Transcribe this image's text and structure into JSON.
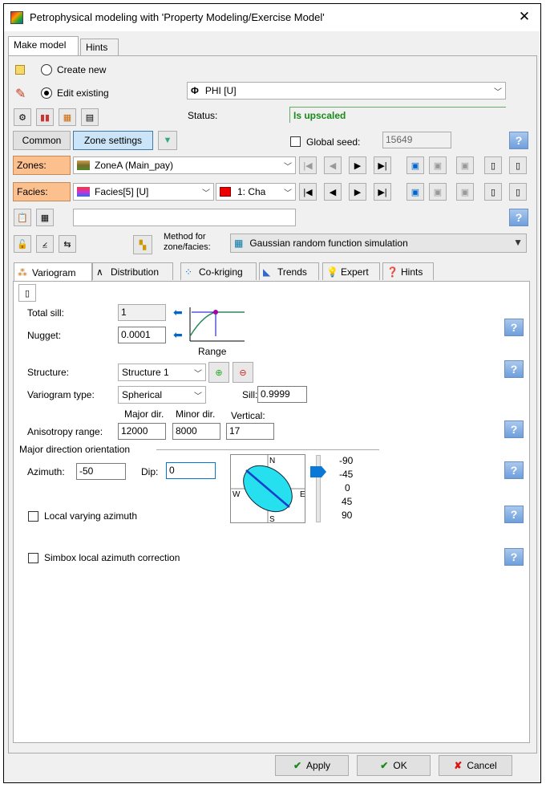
{
  "title": "Petrophysical modeling with 'Property Modeling/Exercise Model'",
  "tabs": [
    "Make model",
    "Hints"
  ],
  "create_new": "Create new",
  "edit_existing": "Edit existing",
  "property": "PHI [U]",
  "status_label": "Status:",
  "status_value": "Is upscaled",
  "common": "Common",
  "zone_settings": "Zone settings",
  "global_seed": "Global seed:",
  "seed_value": "15649",
  "zones_label": "Zones:",
  "zone_value": "ZoneA (Main_pay)",
  "facies_label": "Facies:",
  "facies_value": "Facies[5] [U]",
  "facies_code": "1: Cha",
  "method_label": "Method for\nzone/facies:",
  "method_value": "Gaussian random function simulation",
  "subtabs": [
    "Variogram",
    "Distribution",
    "Co-kriging",
    "Trends",
    "Expert",
    "Hints"
  ],
  "total_sill_label": "Total sill:",
  "total_sill": "1",
  "nugget_label": "Nugget:",
  "nugget": "0.0001",
  "range_label": "Range",
  "structure_label": "Structure:",
  "structure": "Structure 1",
  "vtype_label": "Variogram type:",
  "vtype": "Spherical",
  "sill_label": "Sill:",
  "sill": "0.9999",
  "major_dir": "Major dir.",
  "minor_dir": "Minor dir.",
  "vertical": "Vertical:",
  "aniso_label": "Anisotropy range:",
  "major": "12000",
  "minor": "8000",
  "vert": "17",
  "orient_label": "Major direction orientation",
  "azimuth_label": "Azimuth:",
  "azimuth": "-50",
  "dip_label": "Dip:",
  "dip": "0",
  "compass": {
    "n": "N",
    "s": "S",
    "e": "E",
    "w": "W"
  },
  "dip_scale": [
    "-90",
    "-45",
    "0",
    "45",
    "90"
  ],
  "local_az": "Local varying azimuth",
  "simbox": "Simbox local azimuth correction",
  "apply": "Apply",
  "ok": "OK",
  "cancel": "Cancel"
}
